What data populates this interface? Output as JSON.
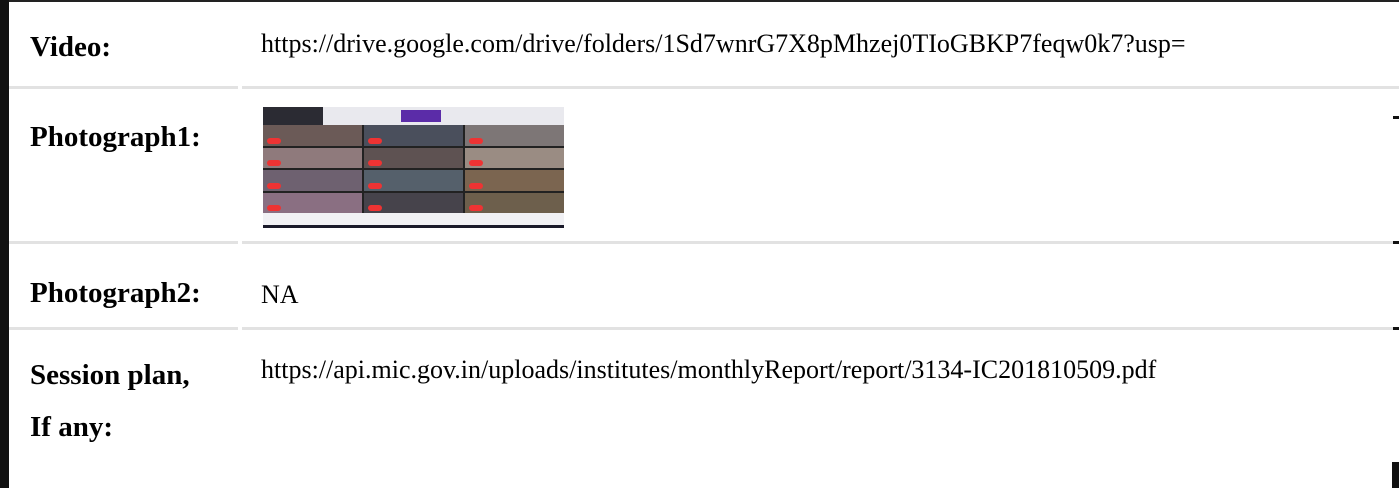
{
  "rows": {
    "video": {
      "label": "Video:",
      "value": "https://drive.google.com/drive/folders/1Sd7wnrG7X8pMhzej0TIoGBKP7feqw0k7?usp="
    },
    "photograph1": {
      "label": "Photograph1:",
      "image_alt": "photograph-thumbnail"
    },
    "photograph2": {
      "label": "Photograph2:",
      "value": "NA"
    },
    "session_plan": {
      "label_line1": "Session plan,",
      "label_line2": "If any:",
      "value": "https://api.mic.gov.in/uploads/institutes/monthlyReport/report/3134-IC201810509.pdf"
    }
  },
  "colors": {
    "frame": "#111111",
    "separator": "#e2e2e2",
    "thumbnail_accent": "#5b2ca8"
  }
}
